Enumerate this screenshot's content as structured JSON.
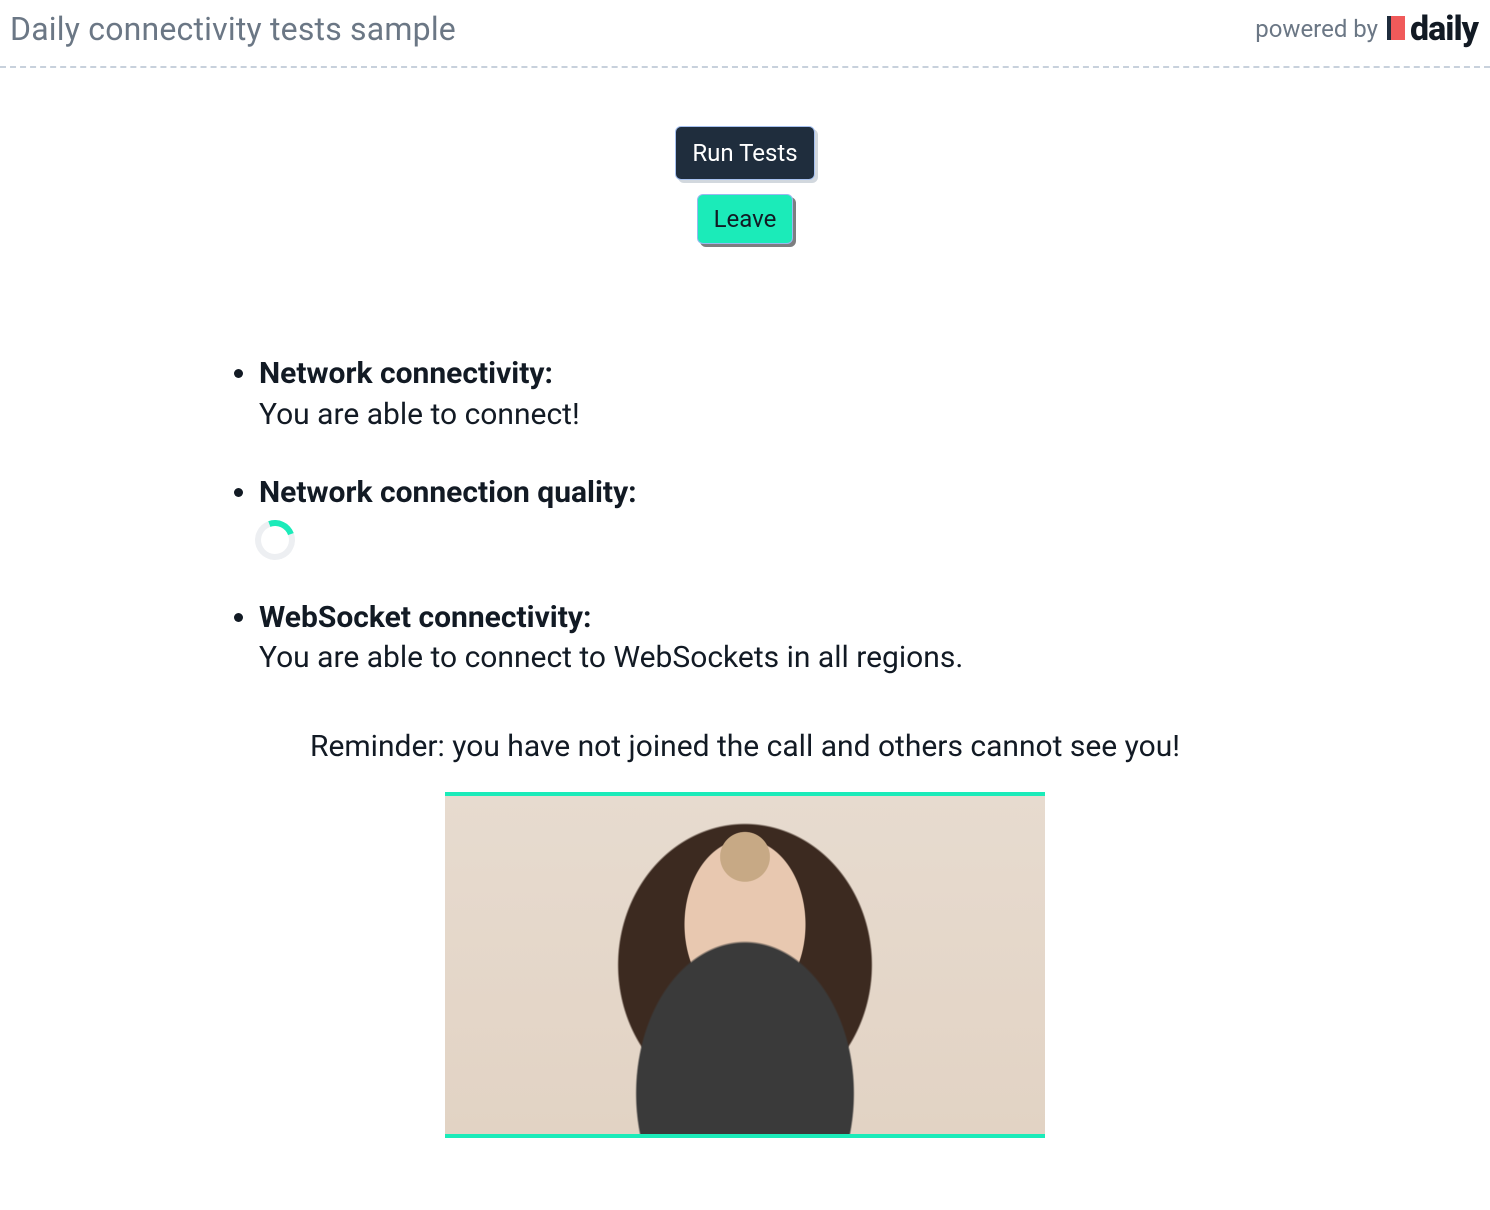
{
  "header": {
    "title": "Daily connectivity tests sample",
    "powered_by": "powered by",
    "brand": "daily"
  },
  "buttons": {
    "run": "Run Tests",
    "leave": "Leave"
  },
  "tests": {
    "network_connectivity": {
      "label": "Network connectivity:",
      "value": "You are able to connect!"
    },
    "network_quality": {
      "label": "Network connection quality:",
      "status": "loading"
    },
    "websocket": {
      "label": "WebSocket connectivity:",
      "value": "You are able to connect to WebSockets in all regions."
    }
  },
  "reminder": "Reminder: you have not joined the call and others cannot see you!",
  "colors": {
    "accent": "#1BEBB9",
    "dark": "#1F2D3D"
  }
}
